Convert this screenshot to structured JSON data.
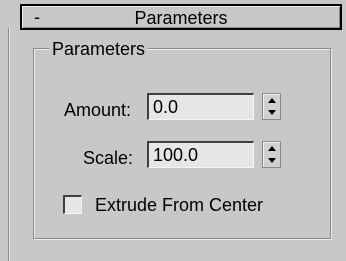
{
  "rollout": {
    "collapse_symbol": "-",
    "title": "Parameters"
  },
  "group": {
    "label": "Parameters"
  },
  "amount": {
    "label": "Amount:",
    "value": "0.0"
  },
  "scale": {
    "label": "Scale:",
    "value": "100.0"
  },
  "extrude": {
    "label": "Extrude From Center",
    "checked": false
  },
  "icons": {
    "spinner": "up-down-spinner-arrows"
  },
  "colors": {
    "panel_bg": "#c8c8c8",
    "field_bg": "#e6e6e6"
  }
}
